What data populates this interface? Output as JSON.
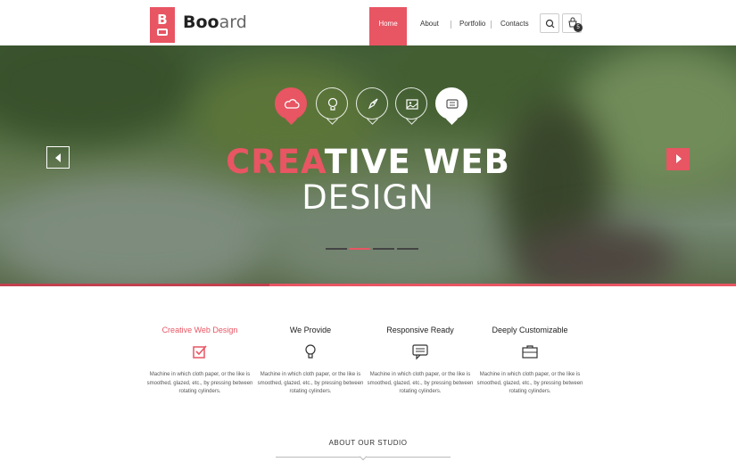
{
  "brand": {
    "logo_letter": "B",
    "name_bold": "Boo",
    "name_light": "ard"
  },
  "nav": {
    "items": [
      "Home",
      "About",
      "Portfolio",
      "Contacts"
    ],
    "cart_count": "5"
  },
  "hero": {
    "headline_red": "CREA",
    "headline_white": "TIVE WEB",
    "subline": "DESIGN",
    "icons": [
      "cloud-icon",
      "lightbulb-icon",
      "rocket-icon",
      "image-icon",
      "chat-icon"
    ],
    "active_slide": 2,
    "slide_count": 4
  },
  "features": [
    {
      "title": "Creative Web Design",
      "icon": "checkbox-icon",
      "text": "Machine in which cloth paper, or the like is smoothed, glazed, etc., by pressing between rotating cylinders."
    },
    {
      "title": "We Provide",
      "icon": "lightbulb-icon",
      "text": "Machine in which cloth paper, or the like is smoothed, glazed, etc., by pressing between rotating cylinders."
    },
    {
      "title": "Responsive Ready",
      "icon": "chat-icon",
      "text": "Machine in which cloth paper, or the like is smoothed, glazed, etc., by pressing between rotating cylinders."
    },
    {
      "title": "Deeply Customizable",
      "icon": "briefcase-icon",
      "text": "Machine in which cloth paper, or the like is smoothed, glazed, etc., by pressing between rotating cylinders."
    }
  ],
  "about": {
    "title": "ABOUT OUR STUDIO"
  },
  "colors": {
    "accent": "#e85563",
    "text": "#222222"
  }
}
